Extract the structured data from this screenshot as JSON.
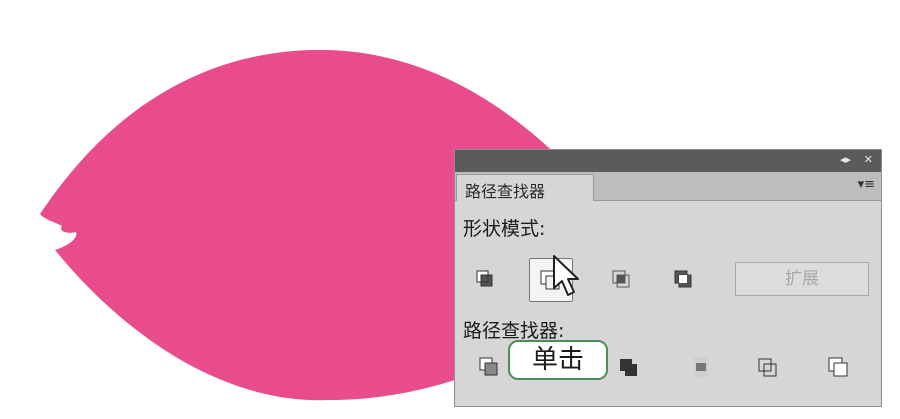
{
  "shape": {
    "name": "pink leaf shape",
    "color": "#e84c8d"
  },
  "panel": {
    "collapse_glyph": "◂▸",
    "close_glyph": "✕",
    "tab_label": "路径查找器",
    "menu_glyph": "▾≡",
    "shape_modes_label": "形状模式:",
    "shape_mode_buttons": [
      "unite-icon",
      "minus-front-icon",
      "intersect-icon",
      "exclude-icon"
    ],
    "expand_label": "扩展",
    "pathfinders_label": "路径查找器:",
    "pathfinder_buttons": [
      "divide-icon",
      "trim-icon",
      "merge-icon",
      "crop-icon",
      "outline-icon",
      "minus-back-icon"
    ]
  },
  "callout": {
    "text": "单击"
  },
  "colors": {
    "panel_bg": "#d6d6d6",
    "titlebar": "#5b5b5b",
    "callout_border": "#4a8f5a"
  }
}
